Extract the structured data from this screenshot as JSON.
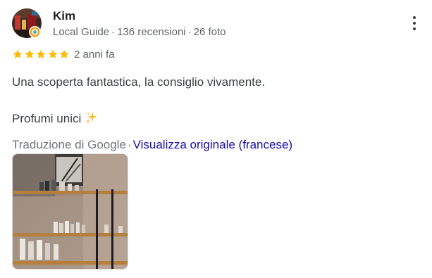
{
  "review": {
    "author": {
      "name": "Kim",
      "level": "Local Guide",
      "reviews_count": "136 recensioni",
      "photos_count": "26 foto",
      "separator": "·",
      "avatar_icon": "avatar-photo"
    },
    "rating": 5,
    "rating_max": 5,
    "time": "2 anni fa",
    "paragraph_1": "Una scoperta fantastica, la consiglio vivamente.",
    "paragraph_2": "Profumi unici",
    "paragraph_2_emoji": "sparkles-icon",
    "translation_label": "Traduzione di Google",
    "translation_separator": "·",
    "view_original": "Visualizza originale (francese)",
    "photos": [
      {
        "description_icon": "review-photo"
      }
    ]
  },
  "colors": {
    "star": "#fbbc04",
    "link": "#1a0dab",
    "secondary_text": "#5f6368",
    "body_text": "#3c4043"
  }
}
